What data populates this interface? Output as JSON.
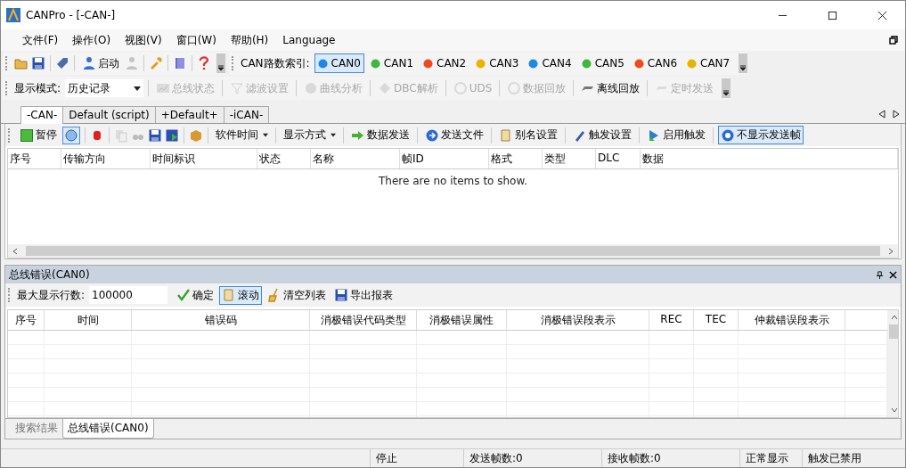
{
  "window": {
    "title": "CANPro - [-CAN-]"
  },
  "menu": [
    {
      "label": "文件(F)"
    },
    {
      "label": "操作(O)"
    },
    {
      "label": "视图(V)"
    },
    {
      "label": "窗口(W)"
    },
    {
      "label": "帮助(H)"
    },
    {
      "label": "Language"
    }
  ],
  "main_toolbar": {
    "start_button": "启动"
  },
  "can_index": {
    "label": "CAN路数索引:",
    "channels": [
      {
        "label": "CAN0",
        "color": "#1e88e5",
        "selected": true
      },
      {
        "label": "CAN1",
        "color": "#3cb83c",
        "selected": false
      },
      {
        "label": "CAN2",
        "color": "#f04a1c",
        "selected": false
      },
      {
        "label": "CAN3",
        "color": "#e8b400",
        "selected": false
      },
      {
        "label": "CAN4",
        "color": "#1e88e5",
        "selected": false
      },
      {
        "label": "CAN5",
        "color": "#3cb83c",
        "selected": false
      },
      {
        "label": "CAN6",
        "color": "#f04a1c",
        "selected": false
      },
      {
        "label": "CAN7",
        "color": "#e8b400",
        "selected": false
      }
    ]
  },
  "display_toolbar": {
    "mode_label": "显示模式:",
    "mode_value": "历史记录",
    "buttons": [
      {
        "label": "总线状态",
        "disabled": true
      },
      {
        "label": "滤波设置",
        "disabled": true
      },
      {
        "label": "曲线分析",
        "disabled": true
      },
      {
        "label": "DBC解析",
        "disabled": true
      },
      {
        "label": "UDS",
        "disabled": true
      },
      {
        "label": "数据回放",
        "disabled": true
      },
      {
        "label": "离线回放",
        "disabled": false
      },
      {
        "label": "定时发送",
        "disabled": true
      }
    ]
  },
  "doc_tabs": [
    {
      "label": "-CAN-",
      "selected": true
    },
    {
      "label": "Default (script)",
      "selected": false
    },
    {
      "label": "+Default+",
      "selected": false
    },
    {
      "label": "-iCAN-",
      "selected": false
    }
  ],
  "can_toolbar": {
    "pause_button": "暂停",
    "items": [
      {
        "label": "软件时间",
        "kind": "menu",
        "pressed": false
      },
      {
        "label": "显示方式",
        "kind": "menu",
        "pressed": false
      },
      {
        "label": "数据发送",
        "kind": "button",
        "pressed": false
      },
      {
        "label": "发送文件",
        "kind": "button",
        "pressed": false
      },
      {
        "label": "别名设置",
        "kind": "button",
        "pressed": false
      },
      {
        "label": "触发设置",
        "kind": "button",
        "pressed": false
      },
      {
        "label": "启用触发",
        "kind": "button",
        "pressed": false
      },
      {
        "label": "不显示发送帧",
        "kind": "button",
        "pressed": true
      }
    ]
  },
  "message_table": {
    "columns": [
      "序号",
      "传输方向",
      "时间标识",
      "状态",
      "名称",
      "帧ID",
      "格式",
      "类型",
      "DLC",
      "数据"
    ],
    "empty_text": "There are no items to show."
  },
  "error_panel": {
    "title": "总线错误(CAN0)",
    "max_rows_label": "最大显示行数:",
    "max_rows_value": "100000",
    "buttons": [
      {
        "label": "确定",
        "pressed": false
      },
      {
        "label": "滚动",
        "pressed": true
      },
      {
        "label": "清空列表",
        "pressed": false
      },
      {
        "label": "导出报表",
        "pressed": false
      }
    ],
    "columns": [
      "序号",
      "时间",
      "错误码",
      "消极错误代码类型",
      "消极错误属性",
      "消极错误段表示",
      "REC",
      "TEC",
      "仲裁错误段表示"
    ]
  },
  "bottom_tabs": [
    {
      "label": "搜索结果",
      "selected": false
    },
    {
      "label": "总线错误(CAN0)",
      "selected": true
    }
  ],
  "status_bar": [
    "停止",
    "发送帧数:0",
    "接收帧数:0",
    "正常显示",
    "触发已禁用"
  ]
}
